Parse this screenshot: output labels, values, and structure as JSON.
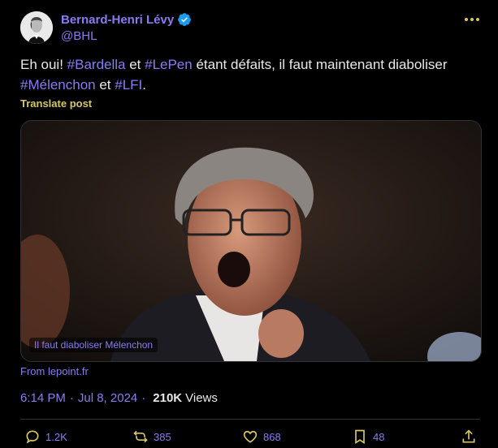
{
  "author": {
    "name": "Bernard-Henri Lévy",
    "handle": "@BHL"
  },
  "tweet": {
    "segments_line1": [
      {
        "text": "Eh oui! ",
        "hashtag": false
      },
      {
        "text": "#Bardella",
        "hashtag": true
      },
      {
        "text": " et ",
        "hashtag": false
      },
      {
        "text": "#LePen",
        "hashtag": true
      },
      {
        "text": " étant défaits, il faut maintenant diaboliser",
        "hashtag": false
      }
    ],
    "segments_line2": [
      {
        "text": "#Mélenchon",
        "hashtag": true
      },
      {
        "text": " et ",
        "hashtag": false
      },
      {
        "text": "#LFI",
        "hashtag": true
      },
      {
        "text": ".",
        "hashtag": false
      }
    ],
    "translate_label": "Translate post"
  },
  "card": {
    "caption": "Il faut diaboliser Mélenchon",
    "source": "From lepoint.fr"
  },
  "meta": {
    "time": "6:14 PM",
    "date": "Jul 8, 2024",
    "views_count": "210K",
    "views_label": "Views"
  },
  "actions": {
    "replies": "1.2K",
    "reposts": "385",
    "likes": "868",
    "bookmarks": "48"
  },
  "colors": {
    "accent": "#8a7cf0",
    "translate": "#d6c766",
    "verified": "#1d9bf0"
  },
  "icons": [
    "verified-icon",
    "more-icon",
    "reply-icon",
    "repost-icon",
    "like-icon",
    "bookmark-icon",
    "share-icon"
  ]
}
